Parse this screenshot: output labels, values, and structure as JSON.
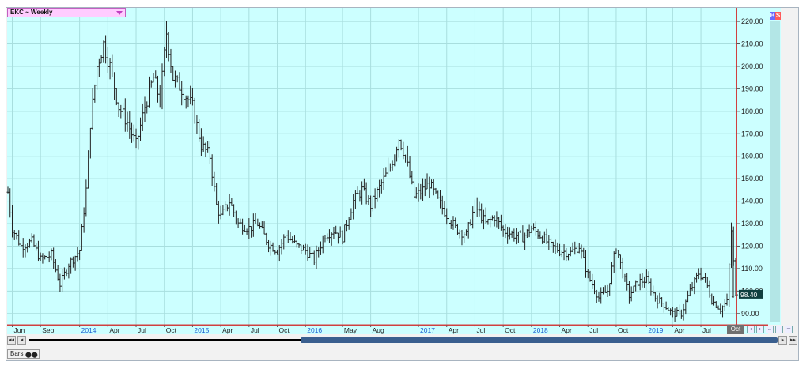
{
  "symbol_selector": {
    "label": "EKC ~ Weekly"
  },
  "badges": [
    {
      "text": "B",
      "color": "#6a6aff"
    },
    {
      "text": "S",
      "color": "#ff5a5a"
    }
  ],
  "last_price_label": "98.40",
  "last_x_tick": "Oct",
  "toolbar": {
    "bars_label": "Bars",
    "bars_icon": "⬤⬤"
  },
  "colors": {
    "plot_bg": "#ccffff",
    "grid": "#a8dede",
    "bars": "#222222",
    "axis_line": "#d04040",
    "year_label": "#2060d0"
  },
  "chart_data": {
    "type": "ohlc",
    "title": "EKC ~ Weekly",
    "xlabel": "",
    "ylabel": "",
    "ylim": [
      85,
      226
    ],
    "y_ticks": [
      90,
      100,
      110,
      120,
      130,
      140,
      150,
      160,
      170,
      180,
      190,
      200,
      210,
      220
    ],
    "y_tick_labels": [
      "90.00",
      "100.00",
      "110.00",
      "120.00",
      "130.00",
      "140.00",
      "150.00",
      "160.00",
      "170.00",
      "180.00",
      "190.00",
      "200.00",
      "210.00",
      "220.00"
    ],
    "x_range": [
      "2013-05-20",
      "2019-10-21"
    ],
    "x_ticks": [
      {
        "label": "Jun",
        "date": "2013-06-03",
        "year": false
      },
      {
        "label": "Sep",
        "date": "2013-09-02",
        "year": false
      },
      {
        "label": "2014",
        "date": "2014-01-06",
        "year": true
      },
      {
        "label": "Apr",
        "date": "2014-04-07",
        "year": false
      },
      {
        "label": "Jul",
        "date": "2014-07-07",
        "year": false
      },
      {
        "label": "Oct",
        "date": "2014-10-06",
        "year": false
      },
      {
        "label": "2015",
        "date": "2015-01-05",
        "year": true
      },
      {
        "label": "Apr",
        "date": "2015-04-06",
        "year": false
      },
      {
        "label": "Jul",
        "date": "2015-07-06",
        "year": false
      },
      {
        "label": "Oct",
        "date": "2015-10-05",
        "year": false
      },
      {
        "label": "2016",
        "date": "2016-01-04",
        "year": true
      },
      {
        "label": "May",
        "date": "2016-05-02",
        "year": false
      },
      {
        "label": "Aug",
        "date": "2016-08-01",
        "year": false
      },
      {
        "label": "2017",
        "date": "2017-01-02",
        "year": true
      },
      {
        "label": "Apr",
        "date": "2017-04-03",
        "year": false
      },
      {
        "label": "Jul",
        "date": "2017-07-03",
        "year": false
      },
      {
        "label": "Oct",
        "date": "2017-10-02",
        "year": false
      },
      {
        "label": "2018",
        "date": "2018-01-01",
        "year": true
      },
      {
        "label": "Apr",
        "date": "2018-04-02",
        "year": false
      },
      {
        "label": "Jul",
        "date": "2018-07-02",
        "year": false
      },
      {
        "label": "Oct",
        "date": "2018-10-01",
        "year": false
      },
      {
        "label": "2019",
        "date": "2019-01-07",
        "year": true
      },
      {
        "label": "Apr",
        "date": "2019-04-01",
        "year": false
      },
      {
        "label": "Jul",
        "date": "2019-07-01",
        "year": false
      }
    ],
    "grid": true,
    "last_price": 98.4,
    "price_path": [
      [
        "2013-05-20",
        144
      ],
      [
        "2013-06-03",
        128
      ],
      [
        "2013-07-01",
        120
      ],
      [
        "2013-08-05",
        122
      ],
      [
        "2013-09-02",
        114
      ],
      [
        "2013-10-07",
        116
      ],
      [
        "2013-11-04",
        103
      ],
      [
        "2013-12-02",
        112
      ],
      [
        "2014-01-06",
        118
      ],
      [
        "2014-01-27",
        145
      ],
      [
        "2014-02-10",
        175
      ],
      [
        "2014-03-03",
        200
      ],
      [
        "2014-03-24",
        210
      ],
      [
        "2014-04-14",
        200
      ],
      [
        "2014-05-12",
        182
      ],
      [
        "2014-06-09",
        175
      ],
      [
        "2014-07-07",
        165
      ],
      [
        "2014-08-04",
        182
      ],
      [
        "2014-09-01",
        195
      ],
      [
        "2014-09-22",
        185
      ],
      [
        "2014-10-13",
        215
      ],
      [
        "2014-11-03",
        195
      ],
      [
        "2014-12-01",
        190
      ],
      [
        "2015-01-05",
        182
      ],
      [
        "2015-02-02",
        165
      ],
      [
        "2015-03-02",
        160
      ],
      [
        "2015-03-23",
        138
      ],
      [
        "2015-04-06",
        133
      ],
      [
        "2015-05-04",
        140
      ],
      [
        "2015-06-01",
        130
      ],
      [
        "2015-07-06",
        128
      ],
      [
        "2015-08-03",
        130
      ],
      [
        "2015-09-07",
        121
      ],
      [
        "2015-10-05",
        118
      ],
      [
        "2015-11-02",
        125
      ],
      [
        "2015-12-07",
        120
      ],
      [
        "2016-01-04",
        118
      ],
      [
        "2016-02-01",
        114
      ],
      [
        "2016-03-07",
        125
      ],
      [
        "2016-04-04",
        127
      ],
      [
        "2016-05-02",
        124
      ],
      [
        "2016-06-06",
        140
      ],
      [
        "2016-07-04",
        145
      ],
      [
        "2016-08-01",
        138
      ],
      [
        "2016-09-05",
        148
      ],
      [
        "2016-10-03",
        155
      ],
      [
        "2016-10-31",
        168
      ],
      [
        "2016-11-21",
        160
      ],
      [
        "2016-12-19",
        142
      ],
      [
        "2017-01-09",
        144
      ],
      [
        "2017-02-06",
        148
      ],
      [
        "2017-03-06",
        140
      ],
      [
        "2017-04-03",
        134
      ],
      [
        "2017-05-01",
        128
      ],
      [
        "2017-06-05",
        125
      ],
      [
        "2017-07-03",
        138
      ],
      [
        "2017-08-07",
        130
      ],
      [
        "2017-09-04",
        133
      ],
      [
        "2017-10-02",
        127
      ],
      [
        "2017-11-06",
        125
      ],
      [
        "2017-12-04",
        124
      ],
      [
        "2018-01-01",
        128
      ],
      [
        "2018-02-05",
        124
      ],
      [
        "2018-03-05",
        120
      ],
      [
        "2018-04-02",
        118
      ],
      [
        "2018-05-07",
        117
      ],
      [
        "2018-06-04",
        120
      ],
      [
        "2018-07-02",
        107
      ],
      [
        "2018-08-06",
        97
      ],
      [
        "2018-09-03",
        100
      ],
      [
        "2018-10-01",
        120
      ],
      [
        "2018-10-22",
        108
      ],
      [
        "2018-11-12",
        98
      ],
      [
        "2018-12-10",
        104
      ],
      [
        "2019-01-07",
        105
      ],
      [
        "2019-02-04",
        97
      ],
      [
        "2019-03-04",
        94
      ],
      [
        "2019-04-01",
        90
      ],
      [
        "2019-04-29",
        90
      ],
      [
        "2019-05-27",
        100
      ],
      [
        "2019-06-24",
        108
      ],
      [
        "2019-07-15",
        105
      ],
      [
        "2019-08-05",
        96
      ],
      [
        "2019-09-02",
        92
      ],
      [
        "2019-09-23",
        95
      ],
      [
        "2019-10-07",
        127
      ],
      [
        "2019-10-21",
        98.4
      ]
    ]
  }
}
